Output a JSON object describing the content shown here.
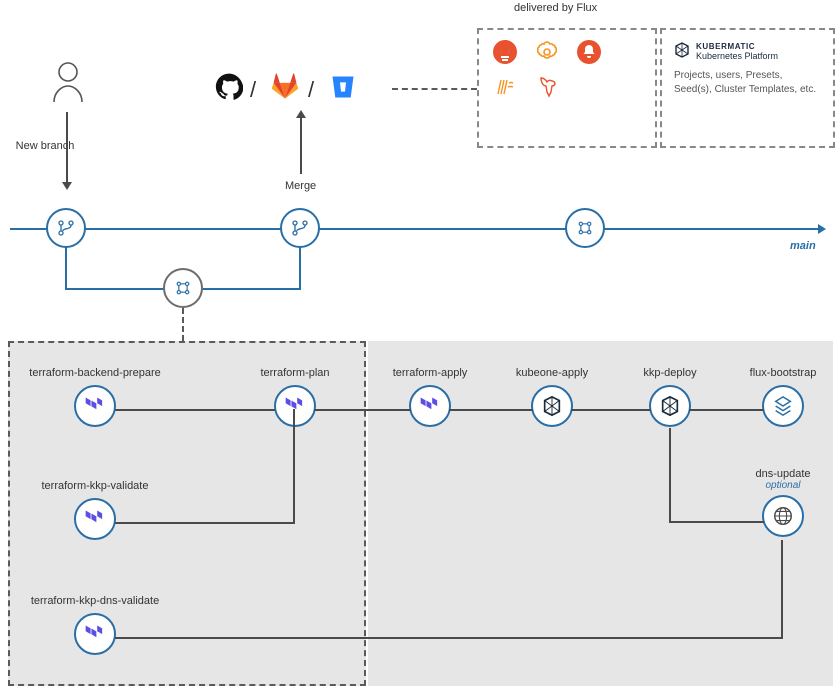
{
  "labels": {
    "deliveredByFlux": "delivered by Flux",
    "newBranch": "New branch",
    "merge": "Merge",
    "main": "main",
    "steps": {
      "tfBackendPrepare": "terraform-backend-prepare",
      "tfPlan": "terraform-plan",
      "tfApply": "terraform-apply",
      "kubeoneApply": "kubeone-apply",
      "kkpDeploy": "kkp-deploy",
      "fluxBootstrap": "flux-bootstrap",
      "tfKkpValidate": "terraform-kkp-validate",
      "dnsUpdate": "dns-update",
      "optional": "optional",
      "tfKkpDnsValidate": "terraform-kkp-dns-validate"
    },
    "kubermatic": {
      "titleBold": "KUBERMATIC",
      "titleLight": "Kubernetes Platform",
      "body": "Projects, users, Presets, Seed(s), Cluster Templates, etc."
    }
  },
  "icons": {
    "user": "user-icon",
    "github": "github-icon",
    "gitlab": "gitlab-icon",
    "bitbucket": "bitbucket-icon",
    "git": "git-branch-icon",
    "gears": "gears-icon",
    "terraform": "terraform-icon",
    "kubeone": "kubeone-icon",
    "kkp": "kubermatic-icon",
    "flux": "flux-icon",
    "globe": "globe-icon",
    "prometheus": "prometheus-icon",
    "grafana": "grafana-icon",
    "alertmanager": "alertmanager-icon",
    "loki": "loki-icon",
    "canary": "canary-icon"
  },
  "colors": {
    "blue": "#2a6ea6",
    "gray": "#6d6d6d",
    "panel": "#e6e6e6",
    "terraform": "#5c4ee5",
    "github": "#111111",
    "gitlab": "#fc6d26",
    "bitbucket": "#2684ff",
    "orangeRed": "#e8522f",
    "orange": "#f7941d"
  }
}
